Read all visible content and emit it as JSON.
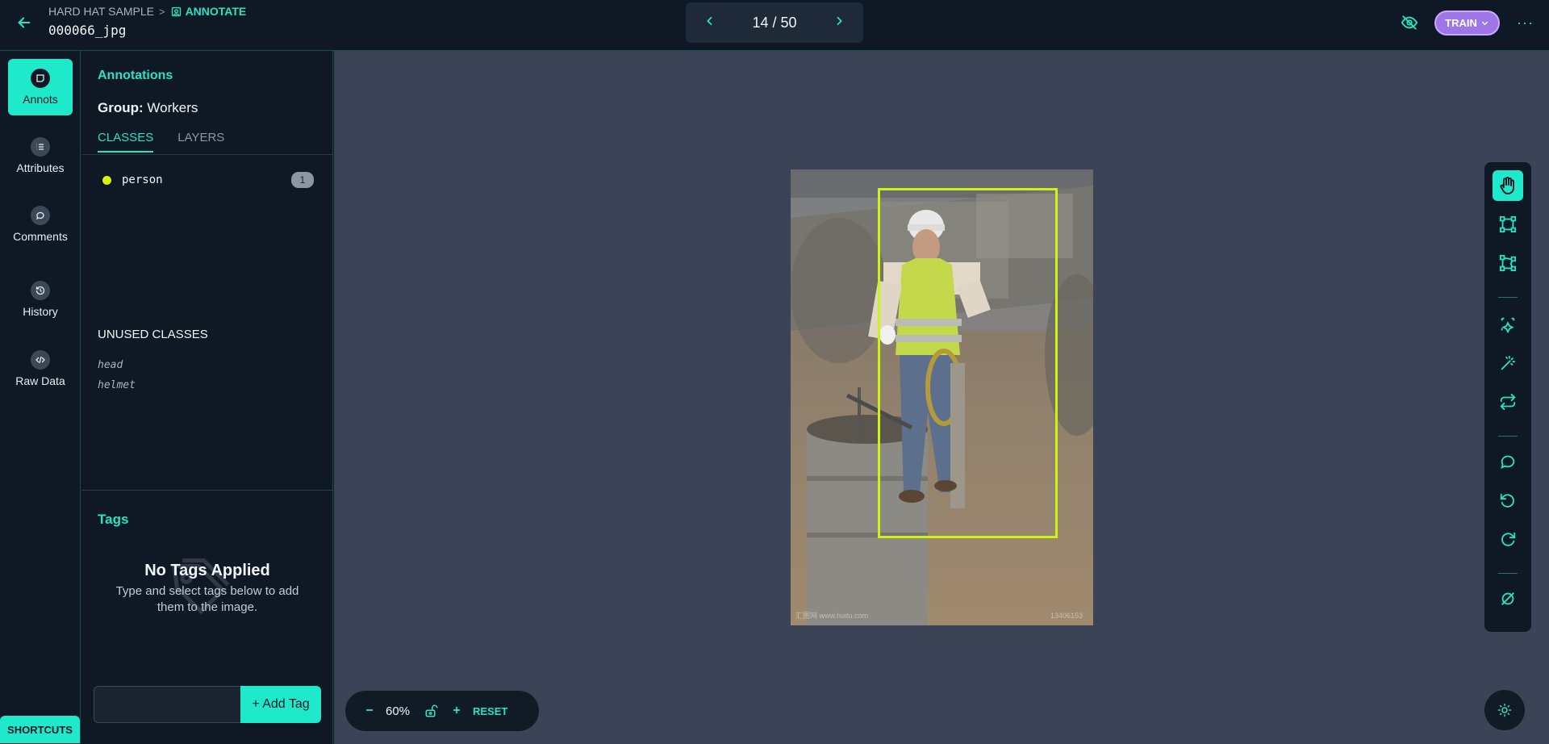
{
  "header": {
    "project": "HARD HAT SAMPLE",
    "separator": ">",
    "mode": "ANNOTATE",
    "filename": "000066_jpg",
    "pager": "14 / 50",
    "train_label": "TRAIN",
    "more": "···"
  },
  "nav": {
    "items": [
      {
        "label": "Annots",
        "icon": "annotation-icon"
      },
      {
        "label": "Attributes",
        "icon": "list-icon"
      },
      {
        "label": "Comments",
        "icon": "comment-icon"
      },
      {
        "label": "History",
        "icon": "history-icon"
      },
      {
        "label": "Raw Data",
        "icon": "code-icon"
      }
    ],
    "shortcuts": "SHORTCUTS"
  },
  "panel": {
    "title": "Annotations",
    "group_label": "Group:",
    "group_value": "Workers",
    "tabs": [
      "CLASSES",
      "LAYERS"
    ],
    "classes": [
      {
        "name": "person",
        "count": "1",
        "color": "#d7f20a"
      }
    ],
    "unused_title": "UNUSED CLASSES",
    "unused": [
      "head",
      "helmet"
    ],
    "tags_title": "Tags",
    "no_tags": "No Tags Applied",
    "no_tags_sub": "Type and select tags below to add them to the image.",
    "add_tag": "+ Add Tag"
  },
  "canvas": {
    "zoom": "60%",
    "reset": "RESET",
    "watermark_left": "汇图网 www.huitu.com",
    "watermark_right": "13406153"
  },
  "colors": {
    "accent": "#1eeacb",
    "bbox": "#cdf316",
    "train": "#9f76e8"
  }
}
